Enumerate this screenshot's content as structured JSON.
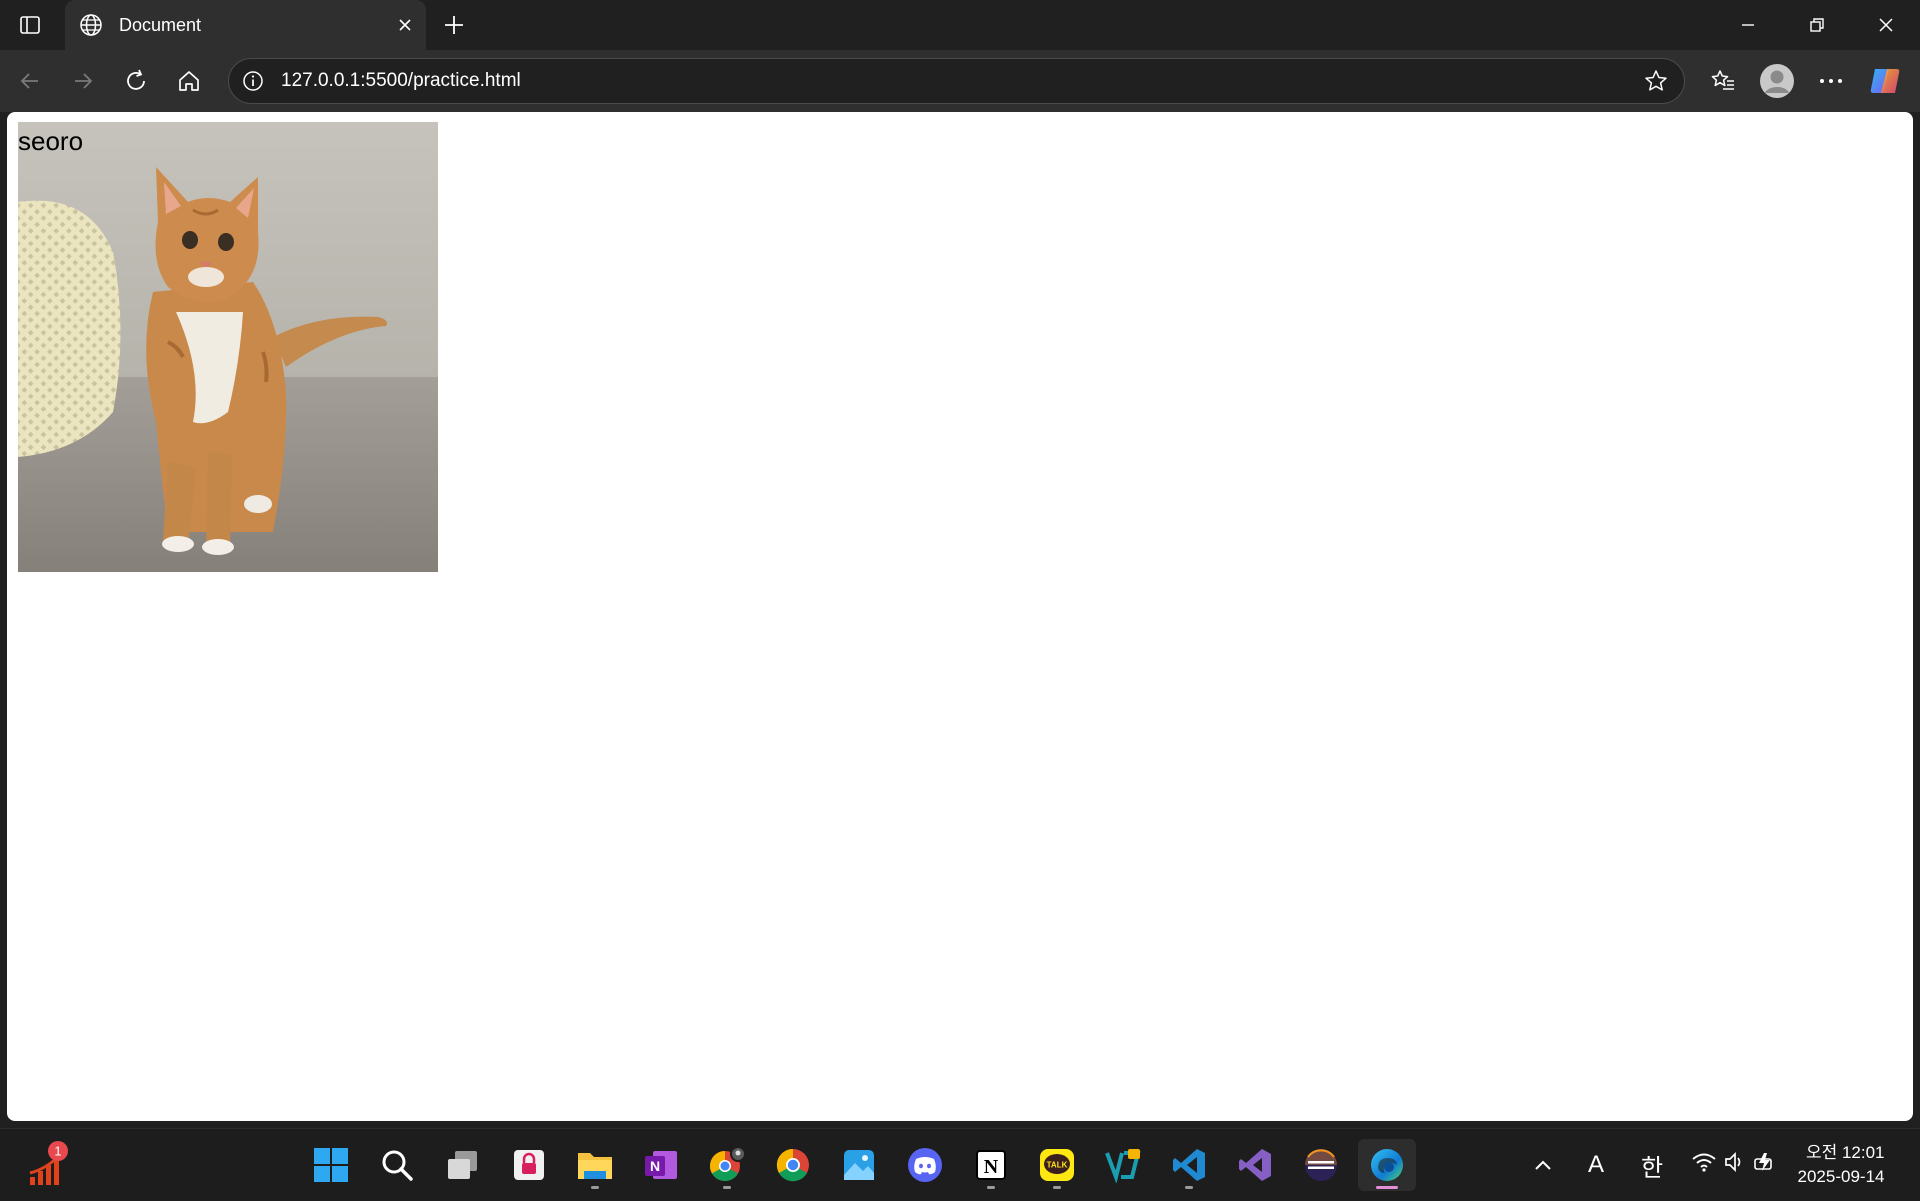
{
  "browser": {
    "tab": {
      "title": "Document"
    },
    "address_bar": {
      "url": "127.0.0.1:5500/practice.html"
    }
  },
  "page": {
    "text": "seoro",
    "image_subject": "orange tabby cat sitting"
  },
  "taskbar": {
    "notification_badge": "1",
    "apps": [
      "start-icon",
      "search-icon",
      "task-view-icon",
      "lock-app-icon",
      "file-explorer-icon",
      "onenote-icon",
      "chrome-profile-icon",
      "chrome-icon",
      "photos-icon",
      "discord-icon",
      "notion-icon",
      "kakaotalk-icon",
      "vs-app-icon",
      "vscode-icon",
      "visual-studio-icon",
      "eclipse-icon",
      "edge-icon"
    ],
    "tray": {
      "ime_mode": "A",
      "ime_lang": "한",
      "time": "오전 12:01",
      "date": "2025-09-14"
    }
  },
  "colors": {
    "accent_edge": "#0f7cd4",
    "active_pip": "#e18fd7"
  }
}
